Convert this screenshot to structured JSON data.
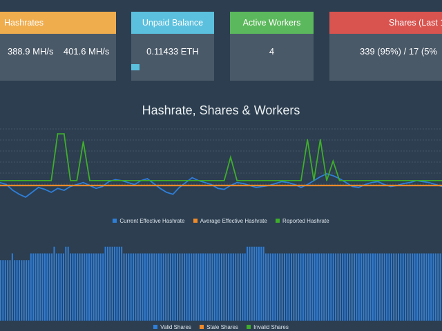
{
  "cards": {
    "hashrates": {
      "title": "Hashrates",
      "values": [
        "/s",
        "388.9 MH/s",
        "401.6 MH/s"
      ],
      "color": "#f0ad4e"
    },
    "unpaid": {
      "title": "Unpaid Balance",
      "value": "0.11433 ETH",
      "progress_fraction": 0.1,
      "color": "#5bc0de"
    },
    "workers": {
      "title": "Active Workers",
      "value": "4",
      "color": "#5cb85c"
    },
    "shares": {
      "title": "Shares (Last 1",
      "value": "339 (95%) / 17 (5%",
      "color": "#d9534f"
    }
  },
  "chart_title": "Hashrate, Shares & Workers",
  "chart_data": [
    {
      "type": "line",
      "series": [
        {
          "name": "Current Effective Hashrate",
          "color": "#2f7ed8",
          "values": [
            390,
            388,
            382,
            378,
            375,
            380,
            385,
            383,
            380,
            384,
            382,
            386,
            388,
            390,
            387,
            384,
            386,
            391,
            393,
            392,
            390,
            388,
            392,
            394,
            389,
            384,
            380,
            378,
            385,
            390,
            395,
            392,
            390,
            388,
            384,
            383,
            387,
            390,
            389,
            387,
            385,
            386,
            387,
            389,
            391,
            390,
            388,
            385,
            388,
            392,
            396,
            399,
            397,
            394,
            390,
            386,
            385,
            388,
            390,
            391,
            388,
            386,
            387,
            389,
            390,
            392,
            391,
            390,
            388,
            386
          ]
        },
        {
          "name": "Average Effective Hashrate",
          "color": "#f28a28",
          "values": [
            387,
            387,
            387,
            387,
            387,
            387,
            387,
            387,
            387,
            387,
            387,
            387,
            387,
            387,
            387,
            387,
            387,
            387,
            387,
            387,
            387,
            387,
            387,
            387,
            387,
            387,
            387,
            387,
            387,
            387,
            387,
            387,
            387,
            387,
            387,
            387,
            387,
            387,
            387,
            387,
            387,
            387,
            387,
            387,
            387,
            387,
            387,
            387,
            387,
            387,
            387,
            387,
            387,
            387,
            387,
            387,
            387,
            387,
            387,
            387,
            387,
            387,
            387,
            387,
            387,
            387,
            387,
            387,
            387,
            387
          ]
        },
        {
          "name": "Reported Hashrate",
          "color": "#3fae2a",
          "values": [
            392,
            392,
            392,
            392,
            392,
            392,
            392,
            392,
            392,
            392,
            392,
            392,
            392,
            392,
            392,
            392,
            392,
            392,
            392,
            392,
            392,
            392,
            392,
            392,
            392,
            392,
            392,
            392,
            392,
            392,
            392,
            392,
            392,
            392,
            392,
            392,
            392,
            392,
            392,
            392,
            392,
            392,
            392,
            392,
            392,
            392,
            392,
            392,
            392,
            392,
            392,
            392,
            392,
            392,
            392,
            392,
            392,
            392,
            392,
            392,
            392,
            392,
            392,
            392,
            392,
            392,
            392,
            392,
            392,
            392
          ],
          "spikes": [
            [
              9,
              440
            ],
            [
              10,
              440
            ],
            [
              13,
              432
            ],
            [
              36,
              416
            ],
            [
              48,
              434
            ],
            [
              50,
              434
            ],
            [
              52,
              412
            ]
          ]
        }
      ],
      "x_count": 70,
      "ylim": [
        370,
        445
      ],
      "grid": true,
      "legend_placement": "bottom"
    },
    {
      "type": "bar",
      "series": [
        {
          "name": "Valid Shares",
          "color": "#2f7ed8",
          "values": [
            9,
            9,
            9,
            9,
            9,
            10,
            9,
            9,
            9,
            9,
            9,
            9,
            9,
            10,
            10,
            10,
            10,
            10,
            10,
            10,
            10,
            10,
            10,
            11,
            10,
            10,
            10,
            10,
            11,
            11,
            10,
            10,
            10,
            10,
            10,
            10,
            10,
            10,
            10,
            10,
            10,
            10,
            10,
            10,
            10,
            11,
            11,
            11,
            11,
            11,
            11,
            11,
            11,
            10,
            10,
            10,
            10,
            10,
            10,
            10,
            10,
            10,
            10,
            10,
            10,
            10,
            10,
            10,
            10,
            10,
            10,
            10,
            10,
            10,
            10,
            10,
            10,
            10,
            10,
            10,
            10,
            10,
            10,
            10,
            10,
            10,
            10,
            10,
            10,
            10,
            10,
            10,
            10,
            10,
            10,
            10,
            10,
            10,
            10,
            10,
            10,
            10,
            10,
            10,
            10,
            10,
            11,
            11,
            11,
            11,
            11,
            11,
            11,
            11,
            10,
            10,
            10,
            10,
            10,
            10,
            10,
            10,
            10,
            10,
            10,
            10,
            10,
            10,
            10,
            10,
            10,
            10,
            10,
            10,
            10,
            10,
            10,
            10,
            10,
            10,
            10,
            10,
            10,
            10,
            10,
            10,
            10,
            10,
            10,
            10,
            10,
            10,
            10,
            10,
            10,
            10,
            10,
            10,
            10,
            10,
            10,
            10,
            10,
            10,
            10,
            10,
            10,
            10,
            10,
            10,
            10,
            10,
            10,
            10,
            10,
            10,
            10,
            10,
            10,
            10,
            10,
            10,
            10,
            10,
            10,
            10,
            10,
            10,
            10,
            10
          ]
        },
        {
          "name": "Stale Shares",
          "color": "#f28a28",
          "values": [
            0,
            0,
            0,
            0,
            0,
            0,
            0,
            0,
            0,
            0,
            0,
            0,
            0,
            0,
            0,
            0,
            0,
            0,
            0,
            0,
            0,
            0,
            0,
            0,
            0,
            0,
            0,
            0,
            0,
            0,
            0,
            0,
            0,
            0,
            0,
            0,
            0,
            0,
            0,
            0,
            0,
            0,
            0,
            0,
            0,
            0,
            0,
            0,
            0,
            0,
            0,
            0,
            0,
            0,
            0,
            0,
            0,
            0,
            0,
            0,
            0,
            0,
            0,
            0,
            0,
            0,
            0,
            0,
            0,
            0,
            0,
            0,
            0,
            0,
            0,
            0,
            0,
            0,
            0,
            0,
            0,
            0,
            0,
            0,
            0,
            0,
            0,
            0,
            0,
            0,
            0,
            0,
            0,
            0,
            0,
            0,
            0,
            0,
            0,
            0,
            0,
            0,
            0,
            0,
            0,
            0,
            0,
            0,
            0,
            0,
            0,
            0,
            0,
            0,
            0,
            0,
            0,
            0,
            0,
            0,
            0,
            0,
            0,
            0,
            0,
            0,
            0,
            0,
            0,
            0,
            0,
            0,
            0,
            0,
            0,
            0,
            0,
            0,
            0,
            0,
            0,
            0,
            0,
            0,
            0,
            0,
            0,
            0,
            0,
            0,
            0,
            0,
            0,
            0,
            0,
            0,
            0,
            0,
            0,
            0,
            0,
            0,
            0,
            0,
            0,
            0,
            0,
            0,
            0,
            0,
            0,
            0,
            0,
            0,
            0,
            0,
            0,
            0,
            0,
            0,
            0,
            0,
            0,
            0,
            0,
            0,
            0,
            0,
            0,
            0
          ]
        },
        {
          "name": "Invalid Shares",
          "color": "#3fae2a",
          "values": []
        }
      ],
      "bar_count": 190,
      "ylim": [
        0,
        12
      ],
      "legend_placement": "bottom"
    }
  ],
  "legend_top": [
    {
      "label": "Current Effective Hashrate",
      "color": "#2f7ed8"
    },
    {
      "label": "Average Effective Hashrate",
      "color": "#f28a28"
    },
    {
      "label": "Reported Hashrate",
      "color": "#3fae2a"
    }
  ],
  "legend_bottom": [
    {
      "label": "Valid Shares",
      "color": "#2f7ed8"
    },
    {
      "label": "Stale Shares",
      "color": "#f28a28"
    },
    {
      "label": "Invalid Shares",
      "color": "#3fae2a"
    }
  ]
}
